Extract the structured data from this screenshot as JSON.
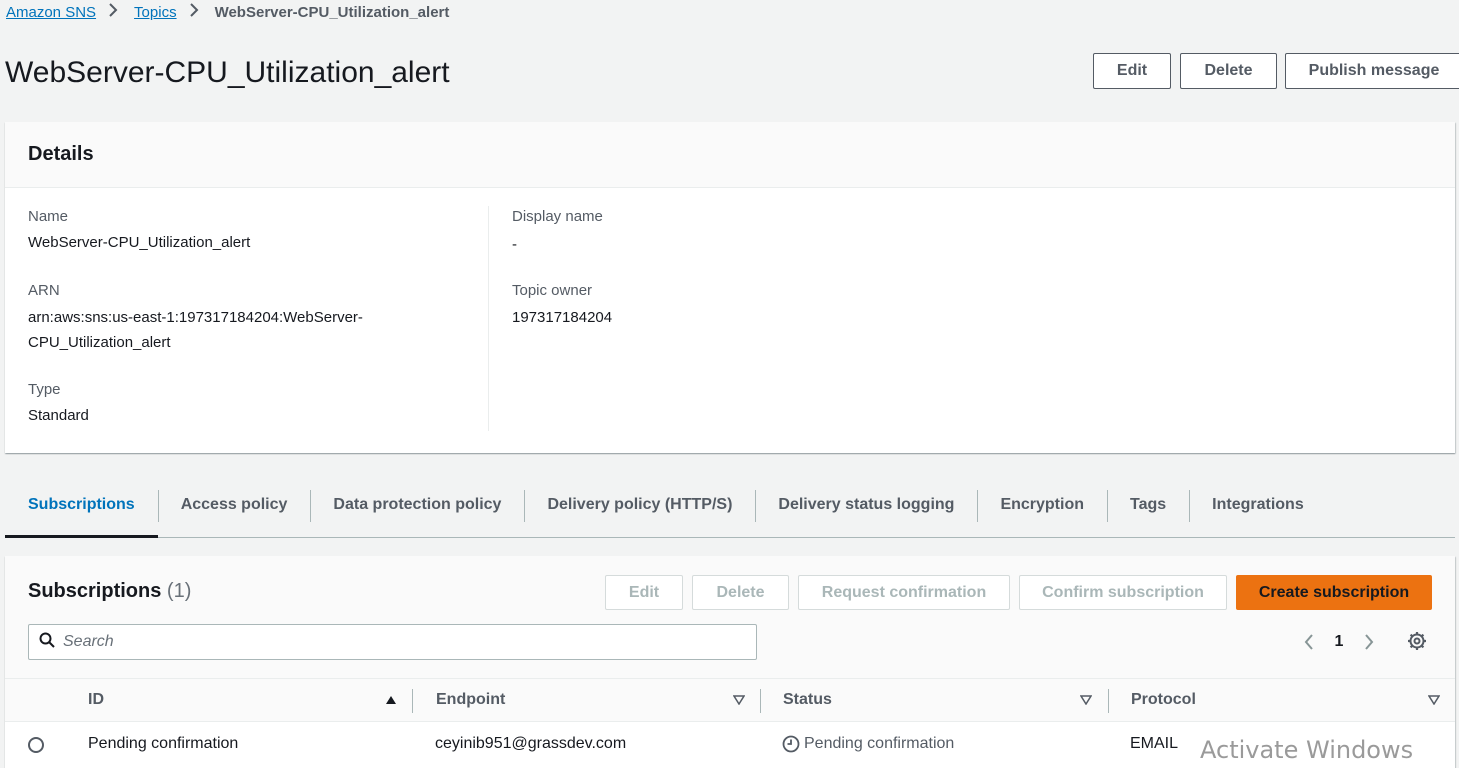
{
  "breadcrumb": {
    "items": [
      {
        "label": "Amazon SNS"
      },
      {
        "label": "Topics"
      }
    ],
    "current": "WebServer-CPU_Utilization_alert"
  },
  "page": {
    "title": "WebServer-CPU_Utilization_alert",
    "actions": {
      "edit": "Edit",
      "delete": "Delete",
      "publish": "Publish message"
    }
  },
  "details": {
    "title": "Details",
    "name_label": "Name",
    "name_value": "WebServer-CPU_Utilization_alert",
    "arn_label": "ARN",
    "arn_value_line1": "arn:aws:sns:us-east-1:197317184204:WebServer-",
    "arn_value_line2": "CPU_Utilization_alert",
    "type_label": "Type",
    "type_value": "Standard",
    "display_name_label": "Display name",
    "display_name_value": "-",
    "owner_label": "Topic owner",
    "owner_value": "197317184204"
  },
  "tabs": [
    {
      "label": "Subscriptions",
      "active": true
    },
    {
      "label": "Access policy"
    },
    {
      "label": "Data protection policy"
    },
    {
      "label": "Delivery policy (HTTP/S)"
    },
    {
      "label": "Delivery status logging"
    },
    {
      "label": "Encryption"
    },
    {
      "label": "Tags"
    },
    {
      "label": "Integrations"
    }
  ],
  "subscriptions": {
    "title": "Subscriptions",
    "count": "(1)",
    "buttons": {
      "edit": "Edit",
      "delete": "Delete",
      "request": "Request confirmation",
      "confirm": "Confirm subscription",
      "create": "Create subscription"
    },
    "search_placeholder": "Search",
    "page": "1",
    "columns": {
      "id": "ID",
      "endpoint": "Endpoint",
      "status": "Status",
      "protocol": "Protocol"
    },
    "rows": [
      {
        "id": "Pending confirmation",
        "endpoint": "ceyinib951@grassdev.com",
        "status": "Pending confirmation",
        "protocol": "EMAIL"
      }
    ]
  },
  "watermark": "Activate Windows",
  "colors": {
    "link": "#0073bb",
    "primary": "#ec7211",
    "background": "#f2f3f3"
  }
}
